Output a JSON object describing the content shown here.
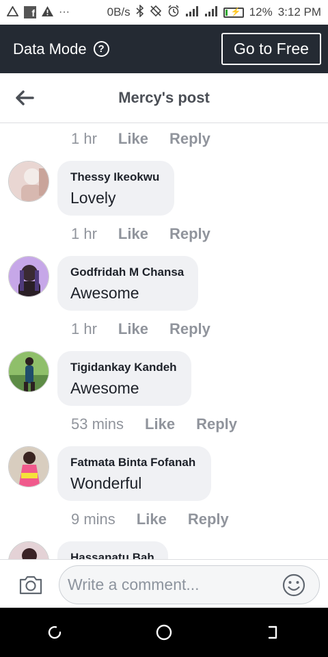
{
  "status_bar": {
    "speed": "0B/s",
    "battery_percent": "12%",
    "time": "3:12 PM",
    "icons": [
      "warning-outline-icon",
      "facebook-icon",
      "warning-icon",
      "more-icon",
      "bluetooth-icon",
      "rotate-icon",
      "alarm-icon",
      "signal-icon",
      "signal-2-icon",
      "battery-charging-icon"
    ],
    "battery_level": 0.12,
    "colors": {
      "battery": "#2ea82e"
    }
  },
  "banner": {
    "title": "Data Mode",
    "cta_label": "Go to Free",
    "background": "#242a33"
  },
  "header": {
    "title": "Mercy's post"
  },
  "comment_actions": {
    "like": "Like",
    "reply": "Reply"
  },
  "top_meta": {
    "time": "1 hr"
  },
  "comments": [
    {
      "author": "Thessy Ikeokwu",
      "text": "Lovely",
      "time": "1 hr"
    },
    {
      "author": "Godfridah M Chansa",
      "text": "Awesome",
      "time": "1 hr"
    },
    {
      "author": "Tigidankay Kandeh",
      "text": "Awesome",
      "time": "53 mins"
    },
    {
      "author": "Fatmata Binta Fofanah",
      "text": "Wonderful",
      "time": "9 mins"
    },
    {
      "author": "Hassanatu Bah",
      "text": "",
      "time": ""
    }
  ],
  "composer": {
    "placeholder": "Write a comment..."
  },
  "colors": {
    "meta_gray": "#90949c",
    "bubble": "#f0f1f4",
    "text": "#1d2129",
    "title": "#4b4f56"
  }
}
